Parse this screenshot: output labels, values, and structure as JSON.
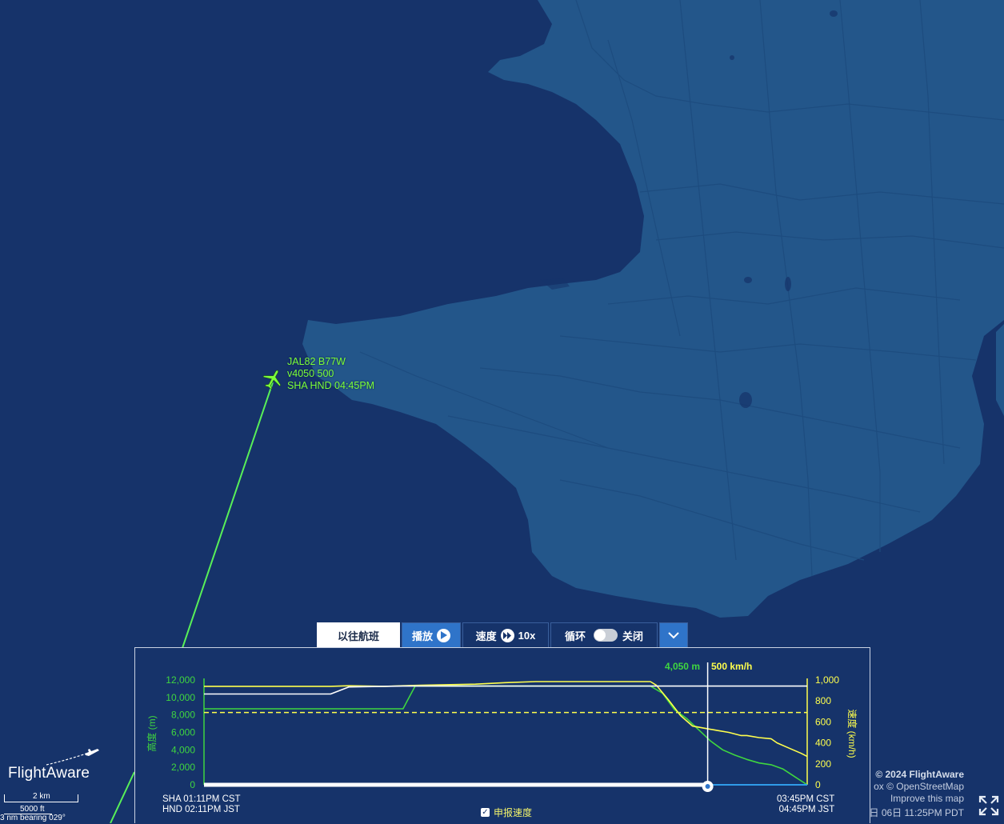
{
  "flight": {
    "line1": "JAL82 B77W",
    "line2": "v4050 500",
    "line3": "SHA HND 04:45PM"
  },
  "toolbar": {
    "history_label": "以往航班",
    "play_label": "播放",
    "speed_label": "速度",
    "speed_value": "10x",
    "loop_label": "循环",
    "loop_state": "关闭",
    "expand_icon": "chevron-down-icon"
  },
  "chart": {
    "altitude_axis_label": "高度 (m)",
    "speed_axis_label": "速度 (km/h)",
    "current_altitude": "4,050 m",
    "current_speed": "500 km/h",
    "start_line1": "SHA 01:11PM CST",
    "start_line2": "HND 02:11PM JST",
    "end_line1": "03:45PM CST",
    "end_line2": "04:45PM JST",
    "checkbox_label": "申报速度",
    "checkbox_checked": true,
    "progress_fraction": 0.835
  },
  "chart_data": {
    "type": "line",
    "x_range": [
      0,
      100
    ],
    "altitude_ticks": [
      "12,000",
      "10,000",
      "8,000",
      "6,000",
      "4,000",
      "2,000",
      "0"
    ],
    "speed_ticks": [
      "1,000",
      "800",
      "600",
      "400",
      "200",
      "0"
    ],
    "ylim_altitude": [
      0,
      12000
    ],
    "ylim_speed": [
      0,
      1000
    ],
    "series": [
      {
        "color": "#3fd63f",
        "x": [
          0,
          21,
          30,
          33,
          35,
          40,
          50,
          60,
          70,
          74,
          76,
          78,
          80,
          82,
          84,
          86,
          88,
          90,
          92,
          94,
          96,
          98,
          100
        ],
        "y": [
          8700,
          8700,
          8700,
          8700,
          11300,
          11300,
          11300,
          11300,
          11300,
          11300,
          10500,
          8600,
          7600,
          6300,
          5000,
          4000,
          3400,
          2900,
          2500,
          2300,
          1800,
          900,
          0
        ]
      },
      {
        "color": "#ffff4d",
        "x": [
          0,
          21,
          24,
          30,
          33,
          36,
          45,
          50,
          55,
          60,
          70,
          74,
          75,
          77,
          79,
          81,
          83,
          85,
          87,
          89,
          90,
          92,
          94,
          95,
          97,
          99,
          100
        ],
        "y": [
          940,
          940,
          945,
          940,
          945,
          950,
          960,
          975,
          985,
          985,
          985,
          985,
          950,
          810,
          660,
          560,
          540,
          520,
          500,
          470,
          470,
          450,
          440,
          400,
          350,
          300,
          270
        ]
      },
      {
        "color": "#ffffff",
        "x": [
          0,
          21,
          24,
          33,
          100
        ],
        "y": [
          10400,
          10400,
          11200,
          11300,
          11300
        ]
      }
    ],
    "reference_lines": [
      {
        "color": "#ffff4d",
        "dashed": true,
        "value_speed": 690
      }
    ]
  },
  "attribution": {
    "copyright": "© 2024 FlightAware",
    "osm": "ox © OpenStreetMap",
    "improve": "Improve this map",
    "date": "日 06日 11:25PM PDT"
  },
  "logo": {
    "text": "FlightAware"
  },
  "scale_bar": {
    "km": "2 km",
    "ft": "5000 ft",
    "bearing": "3 nm bearing 029°"
  },
  "colors": {
    "sea": "#16336a",
    "land": "#23568a",
    "route": "#58f058",
    "altitude": "#3fd63f",
    "speed": "#ffff4d",
    "accent": "#2f74c9"
  }
}
